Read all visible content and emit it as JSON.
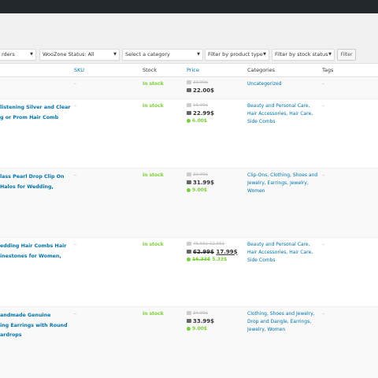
{
  "filters": {
    "product_type_partial": "rders",
    "woozone_status": "WooZone Status: All",
    "category": "Select a category",
    "product_type": "Filter by product type",
    "stock_status": "Filter by stock status",
    "filter_button": "Filter"
  },
  "columns": {
    "sku": "SKU",
    "stock": "Stock",
    "price": "Price",
    "categories": "Categories",
    "tags": "Tags"
  },
  "rows": [
    {
      "name_lines": [],
      "sku": "–",
      "stock": "In stock",
      "price_old": "22.00$",
      "price_current": "22.00$",
      "price_current_strike": "",
      "price_save": "",
      "price_save_strike": "",
      "categories": "Uncategorized",
      "tags": "–"
    },
    {
      "name_lines": [
        "listening Silver and Clear",
        "g or Prom Hair Comb"
      ],
      "sku": "–",
      "stock": "In stock",
      "price_old": "16.99$",
      "price_current": "22.99$",
      "price_current_strike": "",
      "price_save": "6.00$",
      "price_save_strike": "",
      "categories": "Beauty and Personal Care, Hair Accessories, Hair Care, Side Combs",
      "tags": "–"
    },
    {
      "name_lines": [
        "lass Pearl Drop Clip On",
        "Halos for Wedding,"
      ],
      "sku": "–",
      "stock": "In stock",
      "price_old": "22.99$",
      "price_current": "31.99$",
      "price_current_strike": "",
      "price_save": "9.00$",
      "price_save_strike": "",
      "categories": "Clip-Ons, Clothing, Shoes and Jewelry, Earrings, Jewelry, Women",
      "tags": "–"
    },
    {
      "name_lines": [
        "edding Hair Combs Hair",
        "inestones for Women,"
      ],
      "sku": "–",
      "stock": "In stock",
      "price_old": "46.66$ 12.65$",
      "price_current": "17.99$",
      "price_current_strike": "62.99$",
      "price_save": "5.33$",
      "price_save_strike": "16.33$",
      "categories": "Beauty and Personal Care, Hair Accessories, Hair Care, Side Combs",
      "tags": "–"
    },
    {
      "name_lines": [
        "andmade Genuine",
        "ing Earrings with Round",
        "ardrops"
      ],
      "sku": "–",
      "stock": "In stock",
      "price_old": "24.99$",
      "price_current": "33.99$",
      "price_current_strike": "",
      "price_save": "9.00$",
      "price_save_strike": "",
      "categories": "Clothing, Shoes and Jewelry, Drop and Dangle, Earrings, Jewelry, Women",
      "tags": "–"
    }
  ]
}
